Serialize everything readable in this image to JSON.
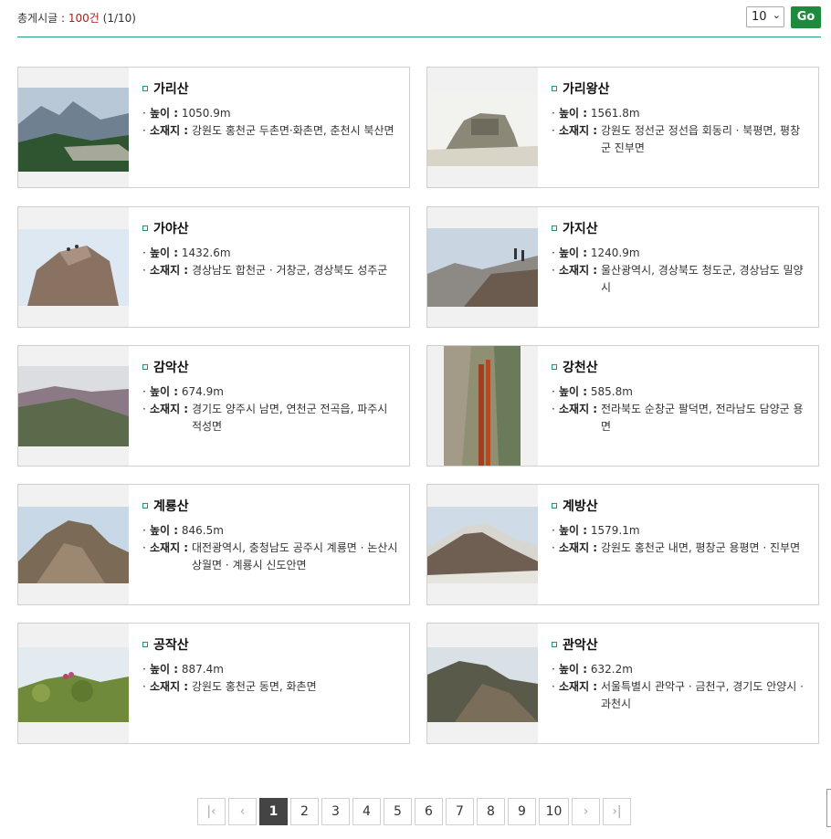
{
  "header": {
    "total_label": "총게시글 :",
    "total_count": "100건",
    "page_info": "(1/10)",
    "per_page": "10",
    "go_label": "Go"
  },
  "labels": {
    "height": "높이 :",
    "location": "소재지 :"
  },
  "mountains": [
    {
      "name": "가리산",
      "height": "1050.9m",
      "location": "강원도 홍천군 두촌면·화촌면, 춘천시 북산면"
    },
    {
      "name": "가리왕산",
      "height": "1561.8m",
      "location": "강원도 정선군 정선읍 회동리 · 북평면, 평창군 진부면"
    },
    {
      "name": "가야산",
      "height": "1432.6m",
      "location": "경상남도 합천군 · 거창군, 경상북도 성주군"
    },
    {
      "name": "가지산",
      "height": "1240.9m",
      "location": "울산광역시, 경상북도 청도군, 경상남도 밀양시"
    },
    {
      "name": "감악산",
      "height": "674.9m",
      "location": "경기도 양주시 남면, 연천군 전곡읍, 파주시 적성면"
    },
    {
      "name": "강천산",
      "height": "585.8m",
      "location": "전라북도 순창군 팔덕면, 전라남도 담양군 용면"
    },
    {
      "name": "계룡산",
      "height": "846.5m",
      "location": "대전광역시, 충청남도 공주시 계룡면 · 논산시 상월면 · 계룡시 신도안면"
    },
    {
      "name": "계방산",
      "height": "1579.1m",
      "location": "강원도 홍천군 내면, 평창군 용평면 · 진부면"
    },
    {
      "name": "공작산",
      "height": "887.4m",
      "location": "강원도 홍천군 동면, 화촌면"
    },
    {
      "name": "관악산",
      "height": "632.2m",
      "location": "서울특별시 관악구 · 금천구, 경기도 안양시 · 과천시"
    }
  ],
  "pagination": {
    "first_icon": "first-page-icon",
    "prev_icon": "prev-page-icon",
    "pages": [
      "1",
      "2",
      "3",
      "4",
      "5",
      "6",
      "7",
      "8",
      "9",
      "10"
    ],
    "current": "1",
    "next_icon": "next-page-icon",
    "last_icon": "last-page-icon"
  },
  "colors": {
    "accent": "#1e9e80",
    "go_button": "#1e8a3c",
    "count_red": "#b0201e",
    "active_page": "#444444"
  }
}
